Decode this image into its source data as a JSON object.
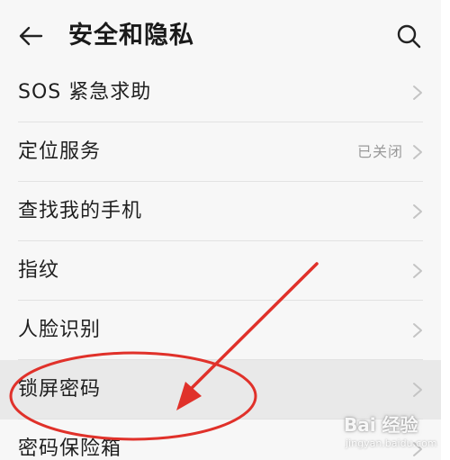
{
  "header": {
    "title": "安全和隐私",
    "back_icon": "arrow-left-icon",
    "search_icon": "search-icon"
  },
  "list": {
    "items": [
      {
        "label": "SOS 紧急求助",
        "status": ""
      },
      {
        "label": "定位服务",
        "status": "已关闭"
      },
      {
        "label": "查找我的手机",
        "status": ""
      },
      {
        "label": "指纹",
        "status": ""
      },
      {
        "label": "人脸识别",
        "status": ""
      },
      {
        "label": "锁屏密码",
        "status": ""
      },
      {
        "label": "密码保险箱",
        "status": ""
      }
    ]
  },
  "annotation": {
    "color": "#e0312a"
  },
  "watermark": {
    "main": "Bai 经验",
    "sub": "jingyan.baidu.com"
  }
}
